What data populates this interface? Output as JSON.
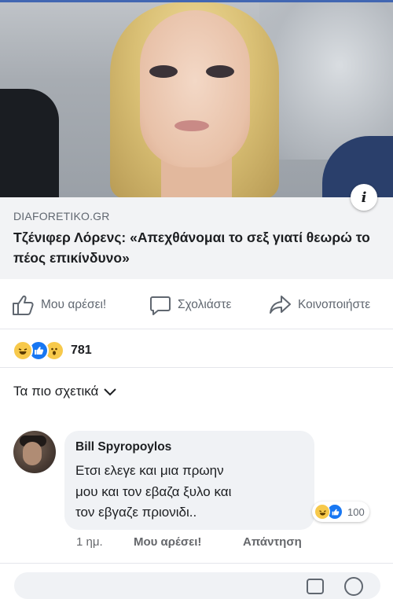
{
  "post": {
    "info_icon": "info-icon",
    "source": "DIAFORETIKO.GR",
    "headline": "Τζένιφερ Λόρενς: «Απεχθάνομαι το σεξ γιατί θεωρώ το πέος επικίνδυνο»"
  },
  "actions": {
    "like_label": "Μου αρέσει!",
    "comment_label": "Σχολιάστε",
    "share_label": "Κοινοποιήστε"
  },
  "reactions": {
    "icons": [
      "haha-icon",
      "like-icon",
      "wow-icon"
    ],
    "count": "781"
  },
  "sort": {
    "label": "Τα πιο σχετικά"
  },
  "comment": {
    "author": "Bill Spyropoylos",
    "lines": [
      "Ετσι ελεγε και μια πρωην",
      "μου και τον εβαζα ξυλο και",
      "τον εβγαζε πριονιδι.."
    ],
    "reaction_count": "100",
    "time": "1 ημ.",
    "like_label": "Μου αρέσει!",
    "reply_label": "Απάντηση"
  },
  "colors": {
    "brand": "#4267b2",
    "like_blue": "#1877f2",
    "haha_yellow": "#f7c94b",
    "secondary_text": "#606770"
  }
}
